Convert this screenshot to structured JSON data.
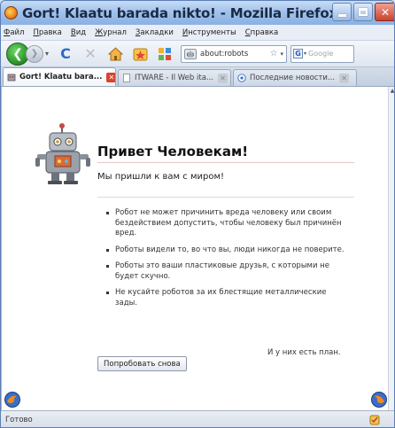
{
  "window": {
    "title": "Gort! Klaatu barada nikto! - Mozilla Firefox"
  },
  "menu": {
    "items": [
      "Файл",
      "Правка",
      "Вид",
      "Журнал",
      "Закладки",
      "Инструменты",
      "Справка"
    ]
  },
  "toolbar": {
    "url": "about:robots",
    "search_placeholder": "Google"
  },
  "tabs": [
    {
      "label": "Gort! Klaatu bara...",
      "active": true
    },
    {
      "label": "ITWARE - Il Web ita...",
      "active": false
    },
    {
      "label": "Последние новости...",
      "active": false
    }
  ],
  "page": {
    "heading": "Привет Человекам!",
    "subheading": "Мы пришли к вам с миром!",
    "laws": [
      "Робот не может причинить вреда человеку или своим бездействием допустить, чтобы человеку был причинён вред.",
      "Роботы видели то, во что вы, люди никогда не поверите.",
      "Роботы это ваши пластиковые друзья, с которыми не будет скучно.",
      "Не кусайте роботов за их блестящие металлические зады."
    ],
    "plan_note": "И у них есть план.",
    "retry_button": "Попробовать снова"
  },
  "status": {
    "text": "Готово"
  },
  "colors": {
    "titlebar": "#9fc0ea",
    "close_button": "#c9432e",
    "back_button": "#2f9b2c"
  }
}
